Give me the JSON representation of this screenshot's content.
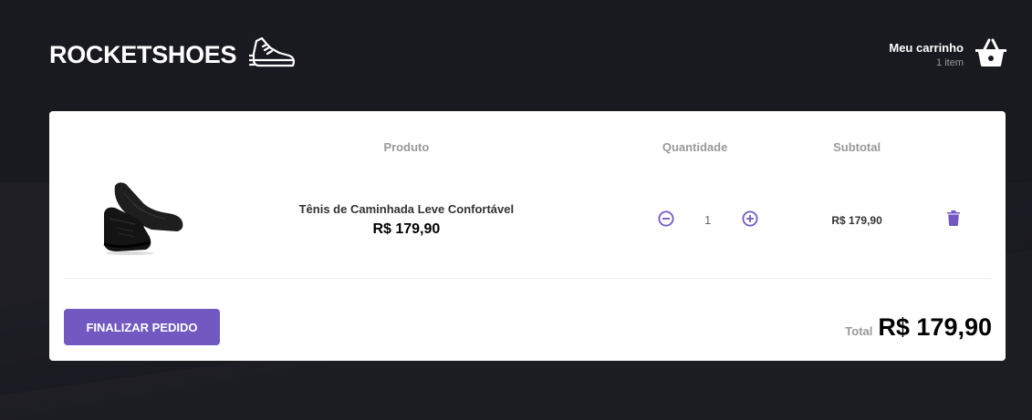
{
  "header": {
    "logo_text": "ROCKETSHOES",
    "logo_icon": "running-shoe-icon",
    "cart_title": "Meu carrinho",
    "cart_count": "1 item",
    "cart_icon": "basket-icon"
  },
  "table": {
    "headers": [
      "Produto",
      "Quantidade",
      "Subtotal"
    ],
    "rows": [
      {
        "image_icon": "black-sneaker-image",
        "name": "Tênis de Caminhada Leve Confortável",
        "price": "R$ 179,90",
        "quantity": "1",
        "subtotal": "R$ 179,90"
      }
    ]
  },
  "footer": {
    "checkout_label": "FINALIZAR PEDIDO",
    "total_label": "Total",
    "total_value": "R$ 179,90"
  },
  "colors": {
    "background": "#191920",
    "accent": "#7159c1",
    "card": "#ffffff"
  }
}
